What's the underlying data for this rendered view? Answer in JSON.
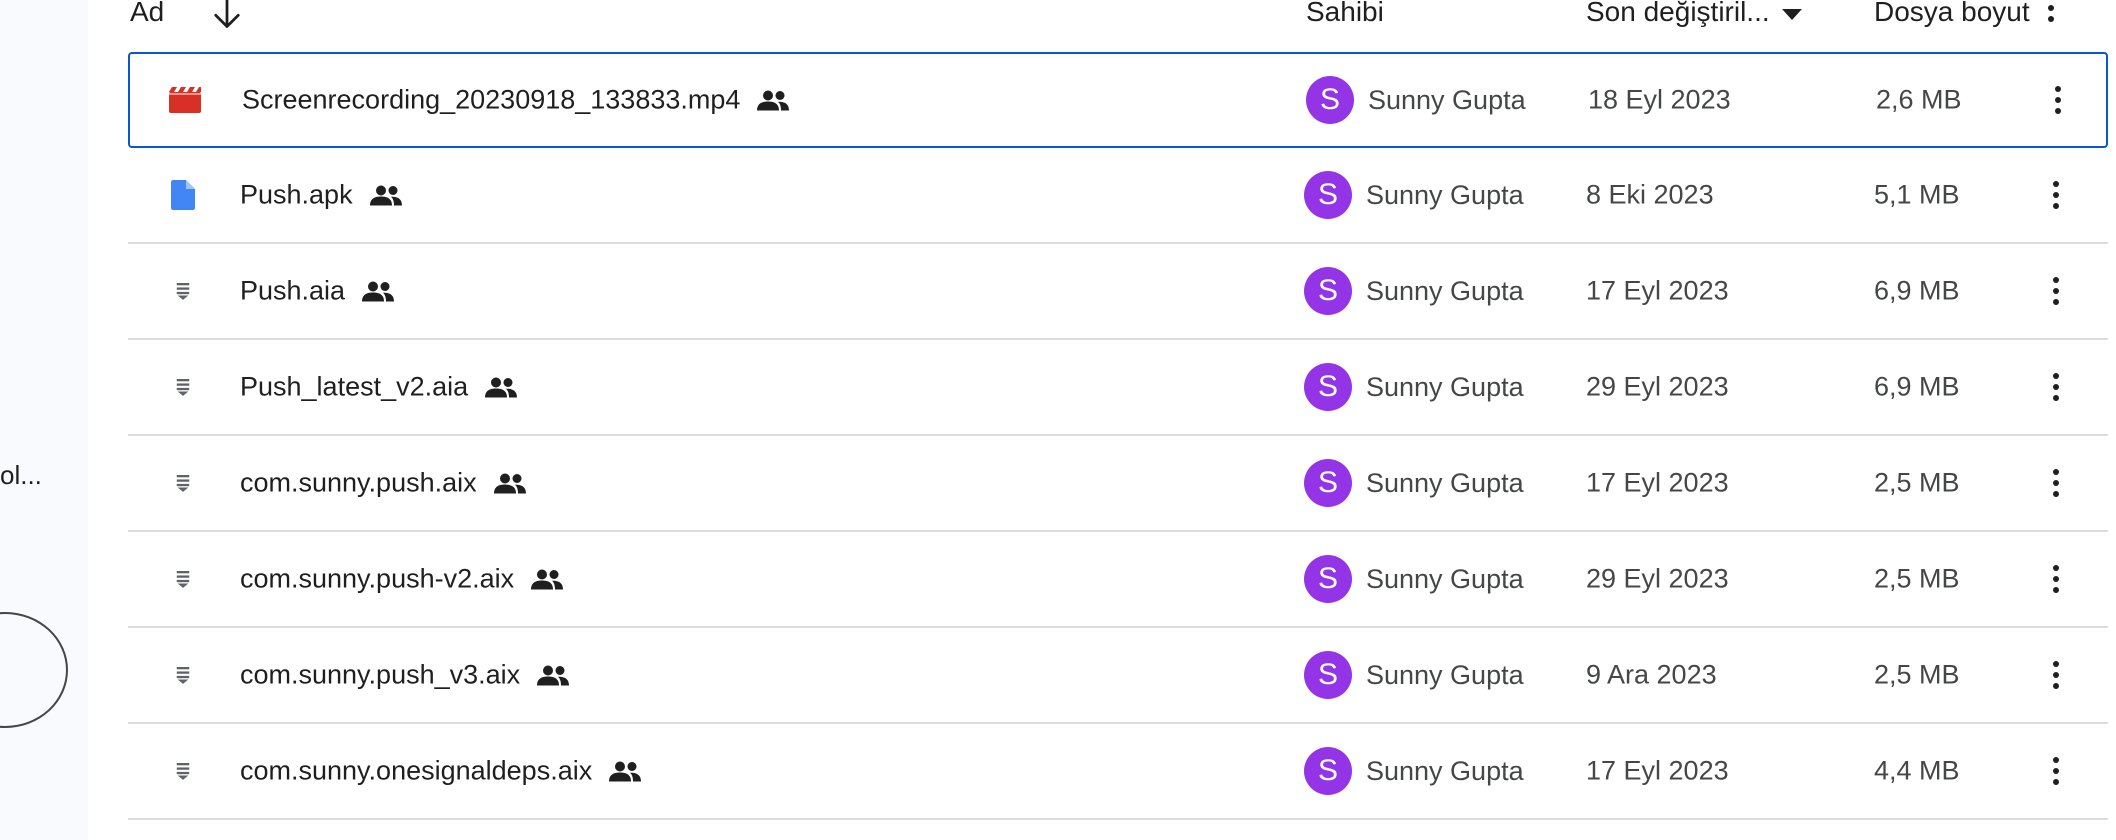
{
  "sidebar": {
    "truncated_label": "ol..."
  },
  "header": {
    "name": "Ad",
    "owner": "Sahibi",
    "modified": "Son değiştiril...",
    "size": "Dosya boyut"
  },
  "rows": [
    {
      "name": "Screenrecording_20230918_133833.mp4",
      "type": "video",
      "owner_initial": "S",
      "owner": "Sunny Gupta",
      "modified": "18 Eyl 2023",
      "size": "2,6 MB"
    },
    {
      "name": "Push.apk",
      "type": "document",
      "owner_initial": "S",
      "owner": "Sunny Gupta",
      "modified": "8 Eki 2023",
      "size": "5,1 MB"
    },
    {
      "name": "Push.aia",
      "type": "archive",
      "owner_initial": "S",
      "owner": "Sunny Gupta",
      "modified": "17 Eyl 2023",
      "size": "6,9 MB"
    },
    {
      "name": "Push_latest_v2.aia",
      "type": "archive",
      "owner_initial": "S",
      "owner": "Sunny Gupta",
      "modified": "29 Eyl 2023",
      "size": "6,9 MB"
    },
    {
      "name": "com.sunny.push.aix",
      "type": "archive",
      "owner_initial": "S",
      "owner": "Sunny Gupta",
      "modified": "17 Eyl 2023",
      "size": "2,5 MB"
    },
    {
      "name": "com.sunny.push-v2.aix",
      "type": "archive",
      "owner_initial": "S",
      "owner": "Sunny Gupta",
      "modified": "29 Eyl 2023",
      "size": "2,5 MB"
    },
    {
      "name": "com.sunny.push_v3.aix",
      "type": "archive",
      "owner_initial": "S",
      "owner": "Sunny Gupta",
      "modified": "9 Ara 2023",
      "size": "2,5 MB"
    },
    {
      "name": "com.sunny.onesignaldeps.aix",
      "type": "archive",
      "owner_initial": "S",
      "owner": "Sunny Gupta",
      "modified": "17 Eyl 2023",
      "size": "4,4 MB"
    }
  ],
  "colors": {
    "accent": "#0b57d0",
    "avatar": "#9334e6",
    "video_icon": "#d93025",
    "doc_icon": "#4285f4",
    "archive_icon": "#5f6368"
  },
  "icons": {
    "sort": "arrow-down-icon",
    "shared": "shared-people-icon",
    "more": "more-vert-icon",
    "video": "video-file-icon",
    "document": "document-file-icon",
    "archive": "archive-file-icon"
  }
}
